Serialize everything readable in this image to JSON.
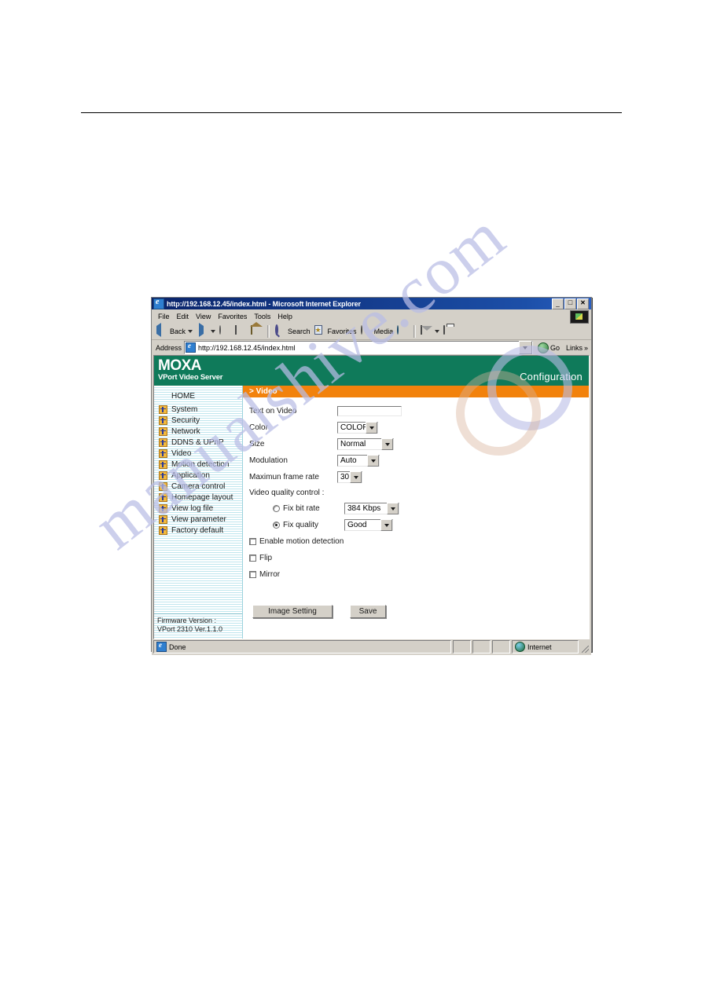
{
  "watermark": {
    "text": "manualshive.com"
  },
  "browser": {
    "title": "http://192.168.12.45/index.html - Microsoft Internet Explorer",
    "title_icon": "ie-document-icon",
    "window_buttons": [
      {
        "name": "minimize-button",
        "glyph": "_"
      },
      {
        "name": "maximize-button",
        "glyph": "□"
      },
      {
        "name": "close-button",
        "glyph": "✕"
      }
    ],
    "menu": [
      {
        "label": "File",
        "accel": "F"
      },
      {
        "label": "Edit",
        "accel": "E"
      },
      {
        "label": "View",
        "accel": "V"
      },
      {
        "label": "Favorites",
        "accel": "a"
      },
      {
        "label": "Tools",
        "accel": "T"
      },
      {
        "label": "Help",
        "accel": "H"
      }
    ],
    "toolbar": [
      {
        "label": "Back",
        "icon": "back-arrow-icon",
        "has_caret": true
      },
      {
        "label": "",
        "icon": "forward-arrow-icon",
        "has_caret": true
      },
      {
        "label": "",
        "icon": "stop-icon",
        "has_caret": false
      },
      {
        "label": "",
        "icon": "refresh-icon",
        "has_caret": false
      },
      {
        "label": "",
        "icon": "home-icon",
        "has_caret": false
      },
      {
        "label": "Search",
        "icon": "search-icon",
        "has_caret": false
      },
      {
        "label": "Favorites",
        "icon": "favorites-star-icon",
        "has_caret": false
      },
      {
        "label": "Media",
        "icon": "media-icon",
        "has_caret": false
      },
      {
        "label": "",
        "icon": "history-globe-icon",
        "has_caret": false
      },
      {
        "label": "",
        "icon": "mail-icon",
        "has_caret": true
      },
      {
        "label": "",
        "icon": "print-icon",
        "has_caret": false
      }
    ],
    "address": {
      "label": "Address",
      "value": "http://192.168.12.45/index.html",
      "placeholder": "",
      "go_label": "Go",
      "links_label": "Links"
    },
    "statusbar": {
      "status": "Done",
      "zone": "Internet"
    }
  },
  "site": {
    "logo": {
      "brand": "MOXA",
      "product": "VPort Video Server"
    },
    "header_title": "Configuration",
    "sidebar": {
      "home_label": "HOME",
      "items": [
        {
          "label": "System"
        },
        {
          "label": "Security"
        },
        {
          "label": "Network"
        },
        {
          "label": "DDNS & UPnP"
        },
        {
          "label": "Video"
        },
        {
          "label": "Motion detection"
        },
        {
          "label": "Application"
        },
        {
          "label": "Camera control"
        },
        {
          "label": "Homepage layout"
        },
        {
          "label": "View log file"
        },
        {
          "label": "View parameter"
        },
        {
          "label": "Factory default"
        }
      ],
      "firmware_label": "Firmware Version :",
      "firmware_value": "VPort 2310 Ver.1.1.0"
    },
    "section": {
      "title": "> Video",
      "fields": {
        "text_on_video": {
          "label": "Text on Video",
          "value": "",
          "placeholder": ""
        },
        "color": {
          "label": "Color",
          "value": "COLOR"
        },
        "size": {
          "label": "Size",
          "value": "Normal"
        },
        "modulation": {
          "label": "Modulation",
          "value": "Auto"
        },
        "max_frame_rate": {
          "label": "Maximun frame rate",
          "value": "30"
        },
        "quality_group_label": "Video quality control :",
        "fix_bit_rate": {
          "label": "Fix bit rate",
          "value": "384 Kbps",
          "selected": false
        },
        "fix_quality": {
          "label": "Fix quality",
          "value": "Good",
          "selected": true
        },
        "enable_motion_detection": {
          "label": "Enable motion detection",
          "checked": false
        },
        "flip": {
          "label": "Flip",
          "checked": false
        },
        "mirror": {
          "label": "Mirror",
          "checked": false
        }
      },
      "buttons": {
        "image_setting": "Image Setting",
        "save": "Save"
      }
    }
  }
}
